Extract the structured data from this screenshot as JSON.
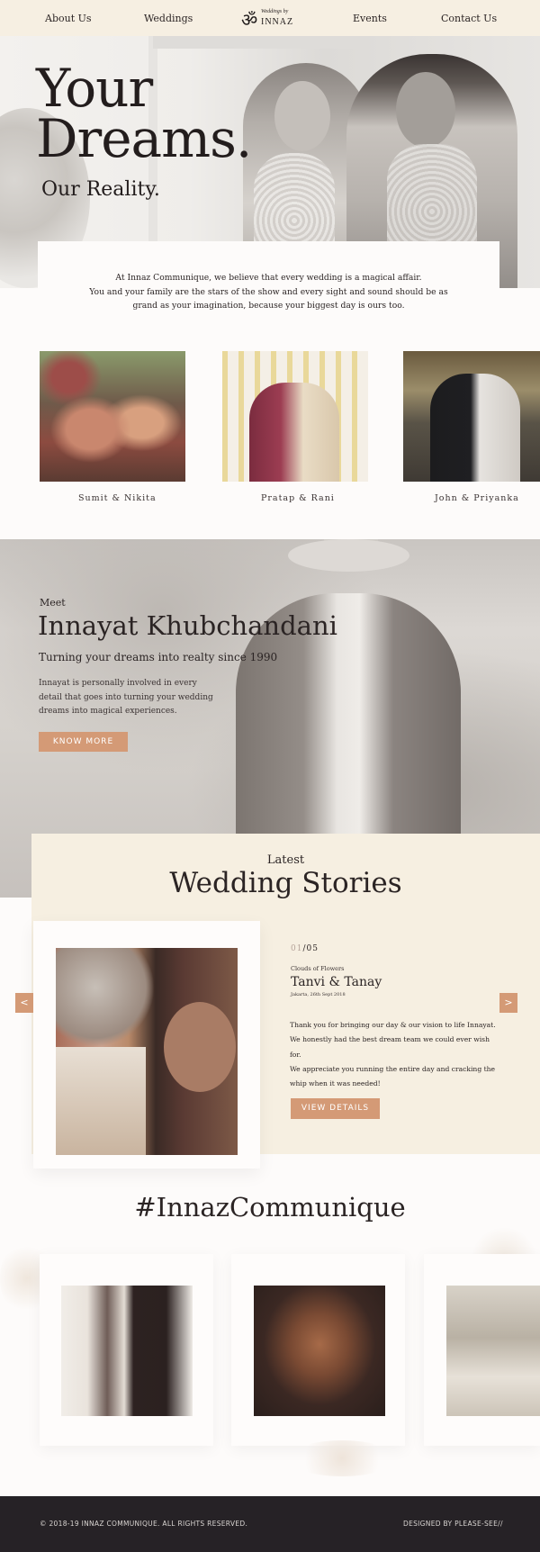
{
  "nav": {
    "about": "About Us",
    "weddings": "Weddings",
    "events": "Events",
    "contact": "Contact Us",
    "logo_small": "Weddings by",
    "logo_name": "INNAZ",
    "logo_icon": "om-icon"
  },
  "hero": {
    "title_line1": "Your",
    "title_line2": "Dreams.",
    "subtitle": "Our Reality."
  },
  "intro": {
    "line1": "At Innaz Communique, we believe that every wedding is a magical affair.",
    "line2": "You and your family are the stars of the show and every sight and sound should be as",
    "line3": "grand as your imagination, because your biggest day is ours too."
  },
  "couples": [
    {
      "name": "Sumit & Nikita"
    },
    {
      "name": "Pratap & Rani"
    },
    {
      "name": "John & Priyanka"
    }
  ],
  "meet": {
    "kicker": "Meet",
    "name": "Innayat Khubchandani",
    "tagline": "Turning your dreams into realty since 1990",
    "text_line1": "Innayat is personally involved in every",
    "text_line2": "detail that goes into turning your wedding",
    "text_line3": "dreams into magical experiences.",
    "button": "KNOW MORE"
  },
  "latest": {
    "kicker": "Latest",
    "heading": "Wedding Stories",
    "counter_current": "01",
    "counter_sep": "/",
    "counter_total": "05",
    "story_kicker": "Clouds of Flowers",
    "story_title": "Tanvi & Tanay",
    "story_date": "Jakarta, 26th Sept 2018",
    "story_line1": "Thank you for bringing our day & our vision to life Innayat.",
    "story_line2": "We honestly had the best dream team we could ever wish for.",
    "story_line3": "We appreciate you running the entire day and cracking the",
    "story_line4": "whip when it was needed!",
    "button": "VIEW DETAILS",
    "prev": "<",
    "next": ">"
  },
  "hashtag": {
    "text": "#InnazCommunique"
  },
  "footer": {
    "copyright": "© 2018-19 INNAZ COMMUNIQUE. ALL RIGHTS RESERVED.",
    "credit": "DESIGNED BY PLEASE-SEE//"
  },
  "colors": {
    "accent": "#d49a76",
    "nav_bg": "#f6efe2",
    "footer_bg": "#262226",
    "text": "#2b2424"
  }
}
